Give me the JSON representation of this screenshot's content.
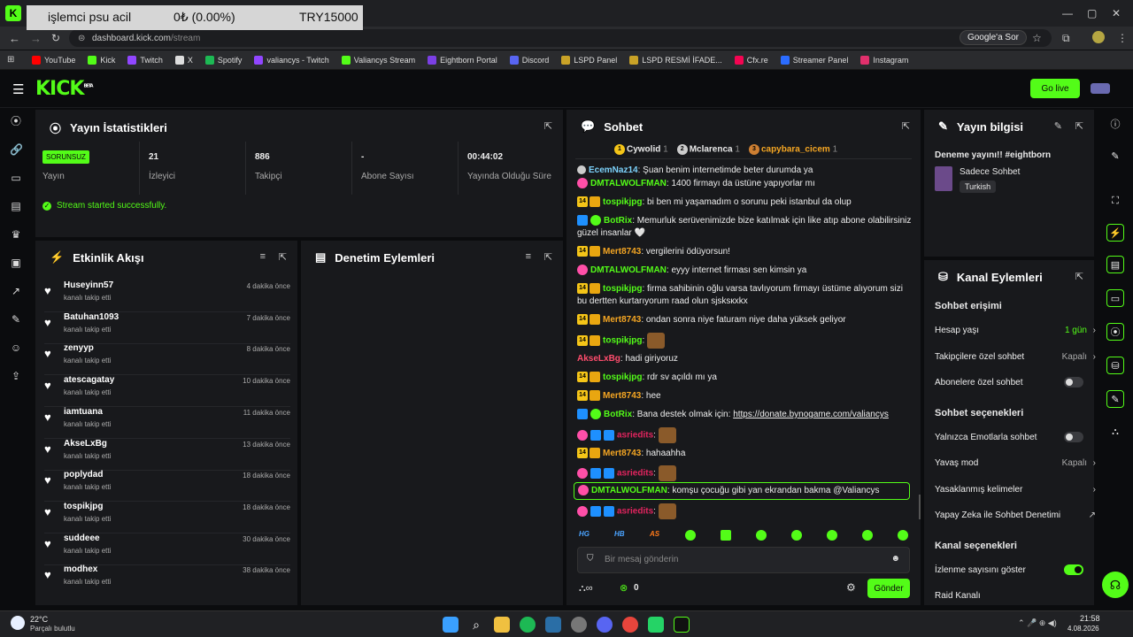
{
  "overlay": {
    "a": "işlemci psu acil",
    "b": "0₺ (0.00%)",
    "c": "TRY15000"
  },
  "browser": {
    "url_host": "dashboard.kick.com",
    "url_path": "/stream",
    "google_btn": "Google'a Sor"
  },
  "bookmarks": [
    {
      "label": "YouTube",
      "color": "#ff0000"
    },
    {
      "label": "Kick",
      "color": "#53fc18"
    },
    {
      "label": "Twitch",
      "color": "#9146ff"
    },
    {
      "label": "X",
      "color": "#dddddd"
    },
    {
      "label": "Spotify",
      "color": "#1db954"
    },
    {
      "label": "valiancys - Twitch",
      "color": "#9146ff"
    },
    {
      "label": "Valiancys Stream",
      "color": "#53fc18"
    },
    {
      "label": "Eightborn Portal",
      "color": "#7b3fe4"
    },
    {
      "label": "Discord",
      "color": "#5865f2"
    },
    {
      "label": "LSPD Panel",
      "color": "#c9a227"
    },
    {
      "label": "LSPD  RESMİ İFADE...",
      "color": "#c9a227"
    },
    {
      "label": "Cfx.re",
      "color": "#f40552"
    },
    {
      "label": "Streamer Panel",
      "color": "#2b6cff"
    },
    {
      "label": "Instagram",
      "color": "#e1306c"
    }
  ],
  "kick": {
    "logo": "KICK",
    "beta": "BETA",
    "go_live": "Go live"
  },
  "stats": {
    "title": "Yayın İstatistikleri",
    "badge": "SORUNSUZ",
    "cells": [
      {
        "v": "",
        "l": "Yayın"
      },
      {
        "v": "21",
        "l": "İzleyici"
      },
      {
        "v": "886",
        "l": "Takipçi"
      },
      {
        "v": "-",
        "l": "Abone Sayısı"
      },
      {
        "v": "00:44:02",
        "l": "Yayında Olduğu Süre"
      }
    ],
    "message": "Stream started successfully."
  },
  "activity": {
    "title": "Etkinlik Akışı",
    "events": [
      {
        "name": "Huseyinn57",
        "sub": "kanalı takip etti",
        "time": "4 dakika önce"
      },
      {
        "name": "Batuhan1093",
        "sub": "kanalı takip etti",
        "time": "7 dakika önce"
      },
      {
        "name": "zenyyp",
        "sub": "kanalı takip etti",
        "time": "8 dakika önce"
      },
      {
        "name": "atescagatay",
        "sub": "kanalı takip etti",
        "time": "10 dakika önce"
      },
      {
        "name": "iamtuana",
        "sub": "kanalı takip etti",
        "time": "11 dakika önce"
      },
      {
        "name": "AkseLxBg",
        "sub": "kanalı takip etti",
        "time": "13 dakika önce"
      },
      {
        "name": "poplydad",
        "sub": "kanalı takip etti",
        "time": "18 dakika önce"
      },
      {
        "name": "tospikjpg",
        "sub": "kanalı takip etti",
        "time": "18 dakika önce"
      },
      {
        "name": "suddeee",
        "sub": "kanalı takip etti",
        "time": "30 dakika önce"
      },
      {
        "name": "modhex",
        "sub": "kanalı takip etti",
        "time": "38 dakika önce"
      }
    ]
  },
  "moderation": {
    "title": "Denetim Eylemleri"
  },
  "chat": {
    "title": "Sohbet",
    "top": [
      {
        "rank": "1",
        "name": "Cywolid",
        "n": "1"
      },
      {
        "rank": "2",
        "name": "Mclarenca",
        "n": "1"
      },
      {
        "rank": "3",
        "name": "capybara_cicem",
        "n": "1"
      }
    ],
    "messages": [
      {
        "badges": "wh",
        "user": "EcemNaz14",
        "color": "#7dd3fc",
        "text": ": Şuan benim internetimde beter durumda ya"
      },
      {
        "badges": "pk",
        "user": "DMTALWOLFMAN",
        "color": "#53fc18",
        "text": ": 1400 firmayı da üstüne yapıyorlar mı"
      },
      {
        "badges": "14cr",
        "user": "tospikjpg",
        "color": "#53fc18",
        "text": ": bi ben mi yaşamadım o sorunu peki istanbul da olup"
      },
      {
        "badges": "blgr",
        "user": "BotRix",
        "color": "#53fc18",
        "text": ": Memurluk serüvenimizde bize katılmak için like atıp abone olabilirsiniz güzel insanlar 🤍"
      },
      {
        "badges": "14cr",
        "user": "Mert8743",
        "color": "#f5a623",
        "text": ": vergilerini ödüyorsun!"
      },
      {
        "badges": "pk",
        "user": "DMTALWOLFMAN",
        "color": "#53fc18",
        "text": ": eyyy internet firması sen kimsin ya"
      },
      {
        "badges": "14cr",
        "user": "tospikjpg",
        "color": "#53fc18",
        "text": ": firma sahibinin oğlu varsa tavlıyorum firmayı üstüme alıyorum sizi bu dertten kurtarıyorum raad olun sjsksкxkx"
      },
      {
        "badges": "14cr",
        "user": "Mert8743",
        "color": "#f5a623",
        "text": ": ondan sonra niye faturam niye daha yüksek geliyor"
      },
      {
        "badges": "14cr",
        "user": "tospikjpg",
        "color": "#53fc18",
        "text": ":",
        "emote": true
      },
      {
        "badges": "",
        "user": "AkseLxBg",
        "color": "#ff4d6d",
        "text": ": hadi giriyoruz"
      },
      {
        "badges": "14cr",
        "user": "tospikjpg",
        "color": "#53fc18",
        "text": ": rdr sv açıldı mı ya"
      },
      {
        "badges": "14cr",
        "user": "Mert8743",
        "color": "#f5a623",
        "text": ": hee"
      },
      {
        "badges": "blgr",
        "user": "BotRix",
        "color": "#53fc18",
        "text": ": Bana destek olmak için: ",
        "link": "https://donate.bynogame.com/valiancys"
      },
      {
        "badges": "pkblbl",
        "user": "asriedits",
        "color": "#e0245e",
        "text": ":",
        "emote": true
      },
      {
        "badges": "14cr",
        "user": "Mert8743",
        "color": "#f5a623",
        "text": ": hahaahha"
      },
      {
        "badges": "pkblbl",
        "user": "asriedits",
        "color": "#e0245e",
        "text": ":",
        "emote": true
      },
      {
        "badges": "pk",
        "user": "DMTALWOLFMAN",
        "color": "#53fc18",
        "text": ": komşu çocuğu gibi yan ekrandan bakma @Valiancys",
        "highlight": true
      },
      {
        "badges": "pkblbl",
        "user": "asriedits",
        "color": "#e0245e",
        "text": ":",
        "emote": true
      }
    ],
    "emotes": [
      "HG",
      "HB",
      "AS"
    ],
    "placeholder": "Bir mesaj gönderin",
    "count": "0",
    "send": "Gönder"
  },
  "info": {
    "title": "Yayın bilgisi",
    "stream_title": "Deneme yayını!! #eightborn",
    "category": "Sadece Sohbet",
    "tag": "Turkish"
  },
  "channel": {
    "title": "Kanal Eylemleri",
    "sec1": "Sohbet erişimi",
    "hesap": "Hesap yaşı",
    "hesap_v": "1 gün",
    "takip": "Takipçilere özel sohbet",
    "takip_v": "Kapalı",
    "abone": "Abonelere özel sohbet",
    "sec2": "Sohbet seçenekleri",
    "emote": "Yalnızca Emotlarla sohbet",
    "yavas": "Yavaş mod",
    "yavas_v": "Kapalı",
    "yasak": "Yasaklanmış kelimeler",
    "ai": "Yapay Zeka ile Sohbet Denetimi",
    "sec3": "Kanal seçenekleri",
    "izlenme": "İzlenme sayısını göster",
    "raid": "Raid Kanalı"
  },
  "taskbar": {
    "temp": "22°C",
    "weather": "Parçalı bulutlu",
    "time": "21:58",
    "date": "4.08.2026"
  },
  "colors": {
    "accent": "#53fc18"
  }
}
